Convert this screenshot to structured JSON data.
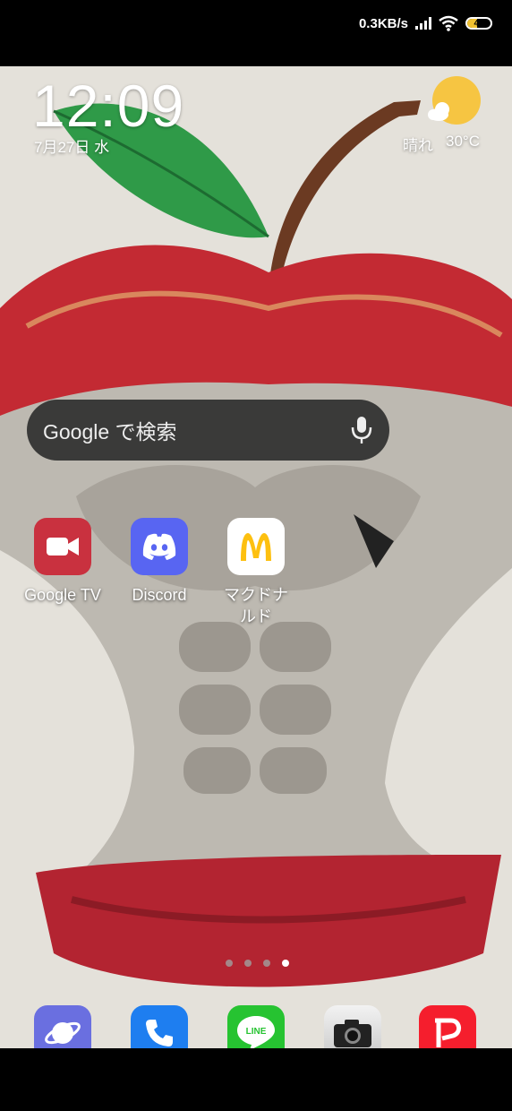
{
  "status_bar": {
    "network_speed": "0.3KB/s",
    "battery_level": "41",
    "battery_fraction": 0.41,
    "battery_color": "#f2c230"
  },
  "clock": {
    "time": "12:09",
    "date": "7月27日 水"
  },
  "weather": {
    "icon": "sun-cloud-icon",
    "condition": "晴れ",
    "temperature": "30°C"
  },
  "search": {
    "label": "Google で検索",
    "icon": "mic-icon"
  },
  "apps": [
    {
      "label": "Google TV",
      "icon": "google-tv-icon",
      "color": "#c9313f"
    },
    {
      "label": "Discord",
      "icon": "discord-icon",
      "color": "#5865f2"
    },
    {
      "label": "マクドナルド",
      "icon": "mcdonalds-icon",
      "color": "#ffffff"
    }
  ],
  "page_indicator": {
    "pages": 4,
    "current": 4
  },
  "dock": [
    {
      "icon": "browser-icon",
      "color": "#6a6fe0"
    },
    {
      "icon": "phone-icon",
      "color": "#1e7ef0"
    },
    {
      "icon": "line-icon",
      "color": "#26c331"
    },
    {
      "icon": "camera-icon",
      "color": "#e5e5e5"
    },
    {
      "icon": "paypay-icon",
      "color": "#f51e2d"
    }
  ]
}
